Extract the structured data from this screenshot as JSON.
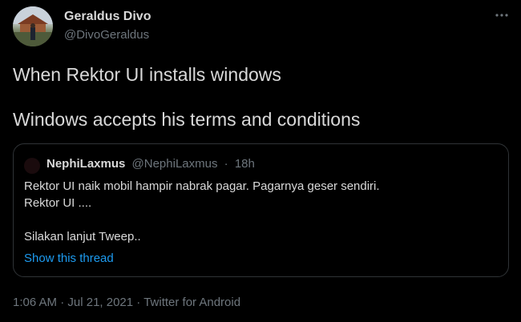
{
  "author": {
    "name": "Geraldus Divo",
    "handle": "@DivoGeraldus"
  },
  "tweet": {
    "lines": [
      "When Rektor UI installs windows",
      "Windows accepts his terms and conditions"
    ]
  },
  "quoted": {
    "name": "NephiLaxmus",
    "handle": "@NephiLaxmus",
    "separator": "·",
    "time": "18h",
    "lines": [
      "Rektor UI naik mobil hampir nabrak pagar. Pagarnya geser sendiri.",
      "Rektor UI ....",
      "",
      "Silakan lanjut Tweep.."
    ],
    "show_thread": "Show this thread"
  },
  "meta": {
    "time": "1:06 AM",
    "separator1": " · ",
    "date": "Jul 21, 2021",
    "separator2": " · ",
    "source": "Twitter for Android"
  },
  "icons": {
    "more": "more-horizontal-icon"
  },
  "colors": {
    "background": "#000000",
    "text": "#d9d9d9",
    "secondary": "#6e767d",
    "link": "#1d9bf0",
    "border": "#2f3336"
  }
}
